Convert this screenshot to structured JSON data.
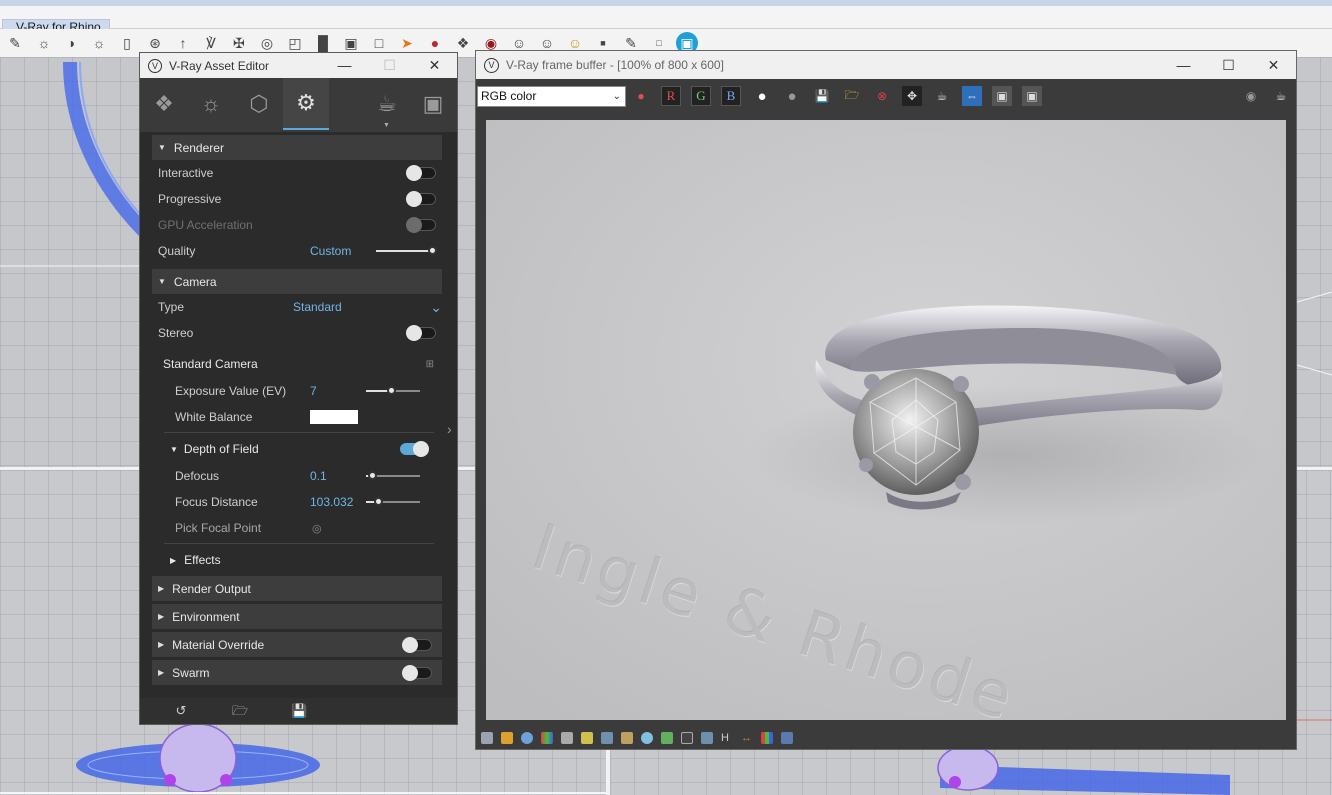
{
  "rhino": {
    "tab_label": "V-Ray for Rhino"
  },
  "asset_editor": {
    "title": "V-Ray Asset Editor",
    "tabs": [
      {
        "icon": "materials-icon"
      },
      {
        "icon": "lights-icon"
      },
      {
        "icon": "geometry-icon"
      },
      {
        "icon": "settings-icon",
        "active": true
      },
      {
        "icon": "render-teapot-icon"
      },
      {
        "icon": "frame-buffer-icon"
      }
    ],
    "renderer": {
      "header": "Renderer",
      "interactive_label": "Interactive",
      "interactive": false,
      "progressive_label": "Progressive",
      "progressive": false,
      "gpu_label": "GPU Acceleration",
      "gpu": false,
      "quality_label": "Quality",
      "quality_value": "Custom",
      "quality_level": 1.0
    },
    "camera": {
      "header": "Camera",
      "type_label": "Type",
      "type_value": "Standard",
      "stereo_label": "Stereo",
      "stereo": false,
      "standard_camera": {
        "header": "Standard Camera",
        "ev_label": "Exposure Value (EV)",
        "ev_value": "7",
        "wb_label": "White Balance",
        "wb_color": "#ffffff"
      },
      "dof": {
        "header": "Depth of Field",
        "enabled": true,
        "defocus_label": "Defocus",
        "defocus_value": "0.1",
        "focus_distance_label": "Focus Distance",
        "focus_distance_value": "103.032",
        "pick_focal_label": "Pick Focal Point"
      },
      "effects_header": "Effects"
    },
    "sections": {
      "render_output": "Render Output",
      "environment": "Environment",
      "material_override": "Material Override",
      "swarm": "Swarm"
    },
    "footer": [
      "undo-icon",
      "open-folder-icon",
      "save-icon"
    ]
  },
  "frame_buffer": {
    "title": "V-Ray frame buffer - [100% of 800 x 600]",
    "channel": "RGB color",
    "channel_buttons": [
      "R",
      "G",
      "B"
    ],
    "watermark": "Ingle & Rhode",
    "accent_color": "#5da7d9"
  }
}
